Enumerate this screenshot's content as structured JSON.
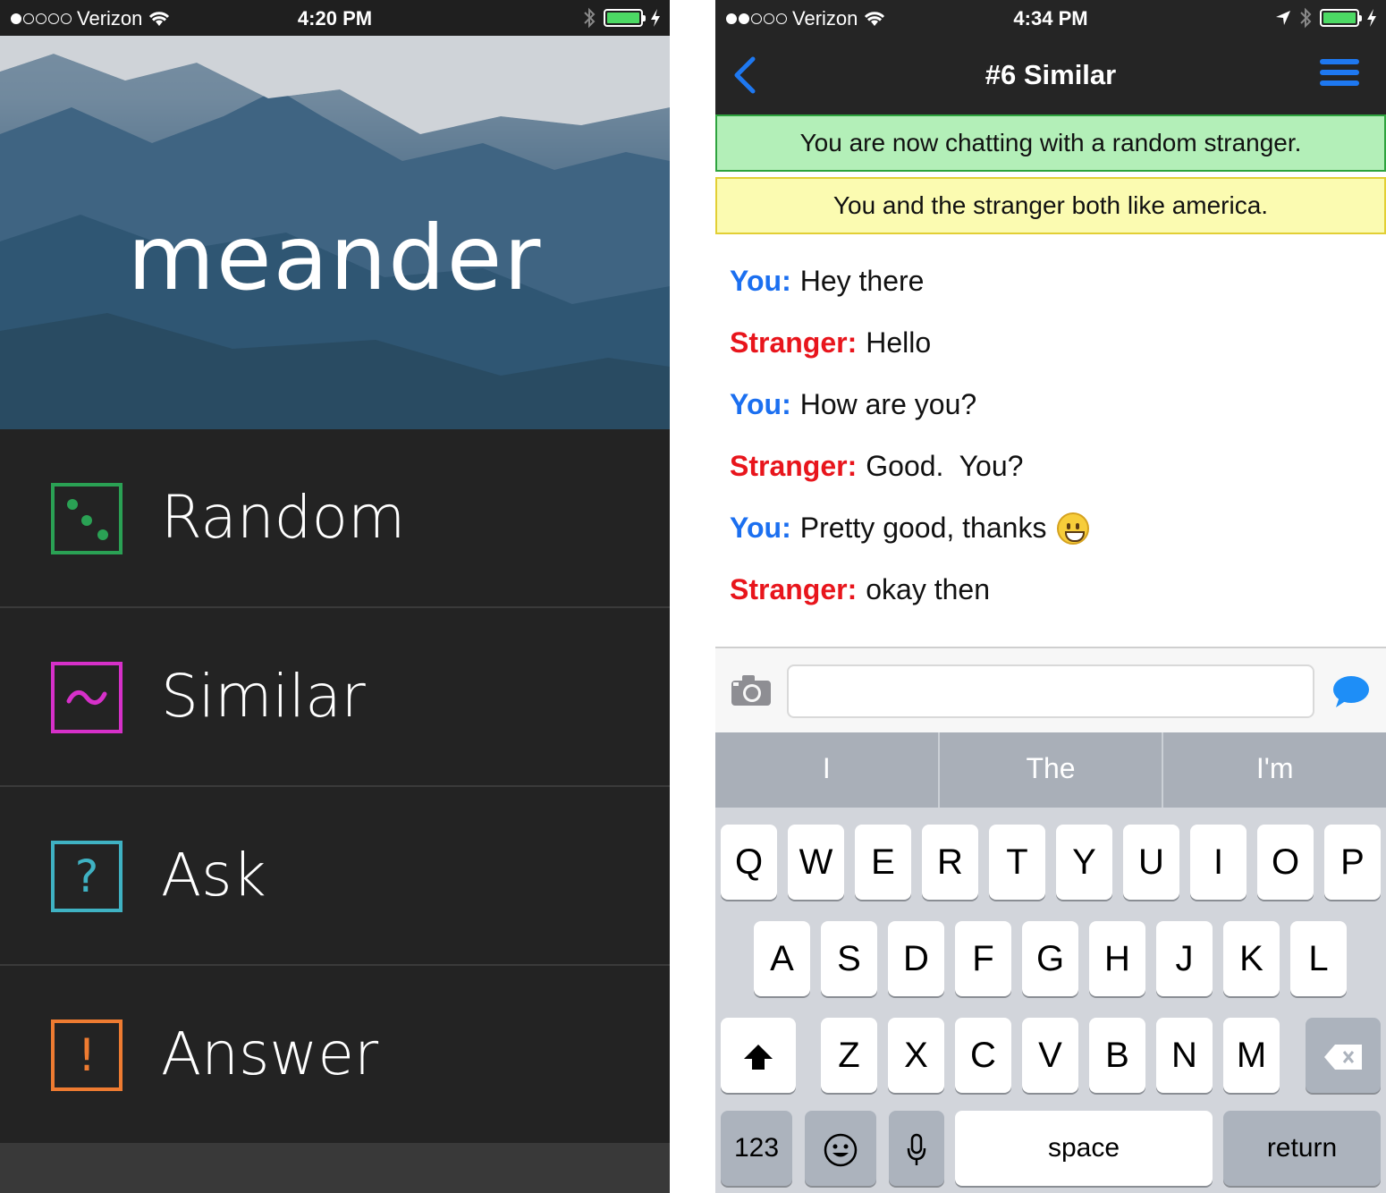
{
  "left_phone": {
    "status": {
      "carrier": "Verizon",
      "time": "4:20 PM"
    },
    "brand": "meander",
    "menu": [
      {
        "label": "Random",
        "color": "#2aa154",
        "icon": "dice-icon"
      },
      {
        "label": "Similar",
        "color": "#d630c9",
        "icon": "tilde-icon"
      },
      {
        "label": "Ask",
        "color": "#3fb2c3",
        "icon": "question-icon",
        "glyph": "?"
      },
      {
        "label": "Answer",
        "color": "#ee7b31",
        "icon": "exclamation-icon",
        "glyph": "!"
      }
    ]
  },
  "right_phone": {
    "status": {
      "carrier": "Verizon",
      "time": "4:34 PM"
    },
    "nav": {
      "title": "#6 Similar"
    },
    "banners": {
      "connected": "You are now chatting with a random stranger.",
      "common_interest": "You and the stranger both like america."
    },
    "messages": [
      {
        "sender": "You:",
        "text": "Hey there"
      },
      {
        "sender": "Stranger:",
        "text": "Hello"
      },
      {
        "sender": "You:",
        "text": "How are you?"
      },
      {
        "sender": "Stranger:",
        "text": "Good.  You?"
      },
      {
        "sender": "You:",
        "text": "Pretty good, thanks"
      },
      {
        "sender": "Stranger:",
        "text": "okay then"
      }
    ],
    "composer": {
      "placeholder": ""
    },
    "predictions": [
      "I",
      "The",
      "I'm"
    ],
    "keyboard": {
      "row1": [
        "Q",
        "W",
        "E",
        "R",
        "T",
        "Y",
        "U",
        "I",
        "O",
        "P"
      ],
      "row2": [
        "A",
        "S",
        "D",
        "F",
        "G",
        "H",
        "J",
        "K",
        "L"
      ],
      "row3": [
        "Z",
        "X",
        "C",
        "V",
        "B",
        "N",
        "M"
      ],
      "numbers": "123",
      "space": "space",
      "return": "return"
    },
    "colors": {
      "you": "#1b6ff0",
      "stranger": "#e8151c",
      "accent": "#1e78f0"
    }
  }
}
